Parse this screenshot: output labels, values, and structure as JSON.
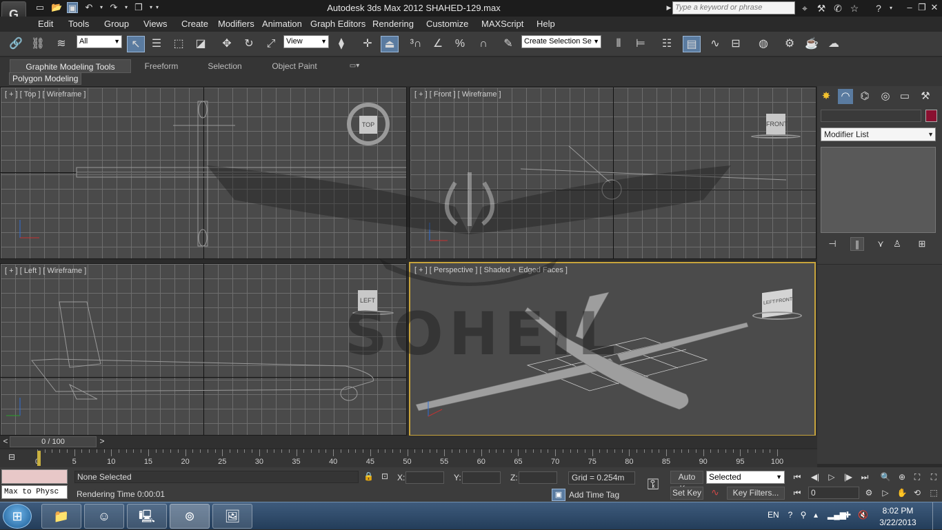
{
  "titlebar": {
    "app_logo": "G",
    "title": "Autodesk 3ds Max  2012     SHAHED-129.max",
    "search_placeholder": "Type a keyword or phrase"
  },
  "menubar": {
    "items": [
      "Edit",
      "Tools",
      "Group",
      "Views",
      "Create",
      "Modifiers",
      "Animation",
      "Graph Editors",
      "Rendering",
      "Customize",
      "MAXScript",
      "Help"
    ]
  },
  "toolbar": {
    "selection_filter": "All",
    "ref_coord": "View",
    "named_selection": "Create Selection Se"
  },
  "ribbon": {
    "tabs": [
      "Graphite Modeling Tools",
      "Freeform",
      "Selection",
      "Object Paint"
    ],
    "panel_button": "Polygon Modeling"
  },
  "viewports": {
    "top": {
      "label": "[ + ] [ Top ] [ Wireframe ]",
      "cube": "TOP"
    },
    "front": {
      "label": "[ + ] [ Front ] [ Wireframe ]",
      "cube": "FRONT"
    },
    "left": {
      "label": "[ + ] [ Left ] [ Wireframe ]",
      "cube": "LEFT"
    },
    "perspective": {
      "label": "[ + ] [ Perspective ] [ Shaded + Edged Faces ]",
      "cube": "FRONT",
      "cube_side": "LEFT"
    }
  },
  "watermark": "SOHEIL",
  "command_panel": {
    "modifier_list": "Modifier List",
    "object_color": "#8a1030"
  },
  "timeslider": {
    "frame": "0 / 100",
    "left_arrow": "<",
    "right_arrow": ">"
  },
  "trackbar": {
    "labels": [
      "0",
      "5",
      "10",
      "15",
      "20",
      "25",
      "30",
      "35",
      "40",
      "45",
      "50",
      "55",
      "60",
      "65",
      "70",
      "75",
      "80",
      "85",
      "90",
      "95",
      "100"
    ]
  },
  "status": {
    "maxscript_listener": "Max to Physc",
    "selection": "None Selected",
    "render_time": "Rendering Time  0:00:01",
    "x_label": "X:",
    "y_label": "Y:",
    "z_label": "Z:",
    "grid": "Grid = 0.254m",
    "add_time_tag": "Add Time Tag",
    "auto_key": "Auto Key",
    "set_key": "Set Key",
    "key_mode": "Selected",
    "key_filters": "Key Filters...",
    "current_frame": "0"
  },
  "taskbar": {
    "language": "EN",
    "time": "8:02 PM",
    "date": "3/22/2013"
  }
}
